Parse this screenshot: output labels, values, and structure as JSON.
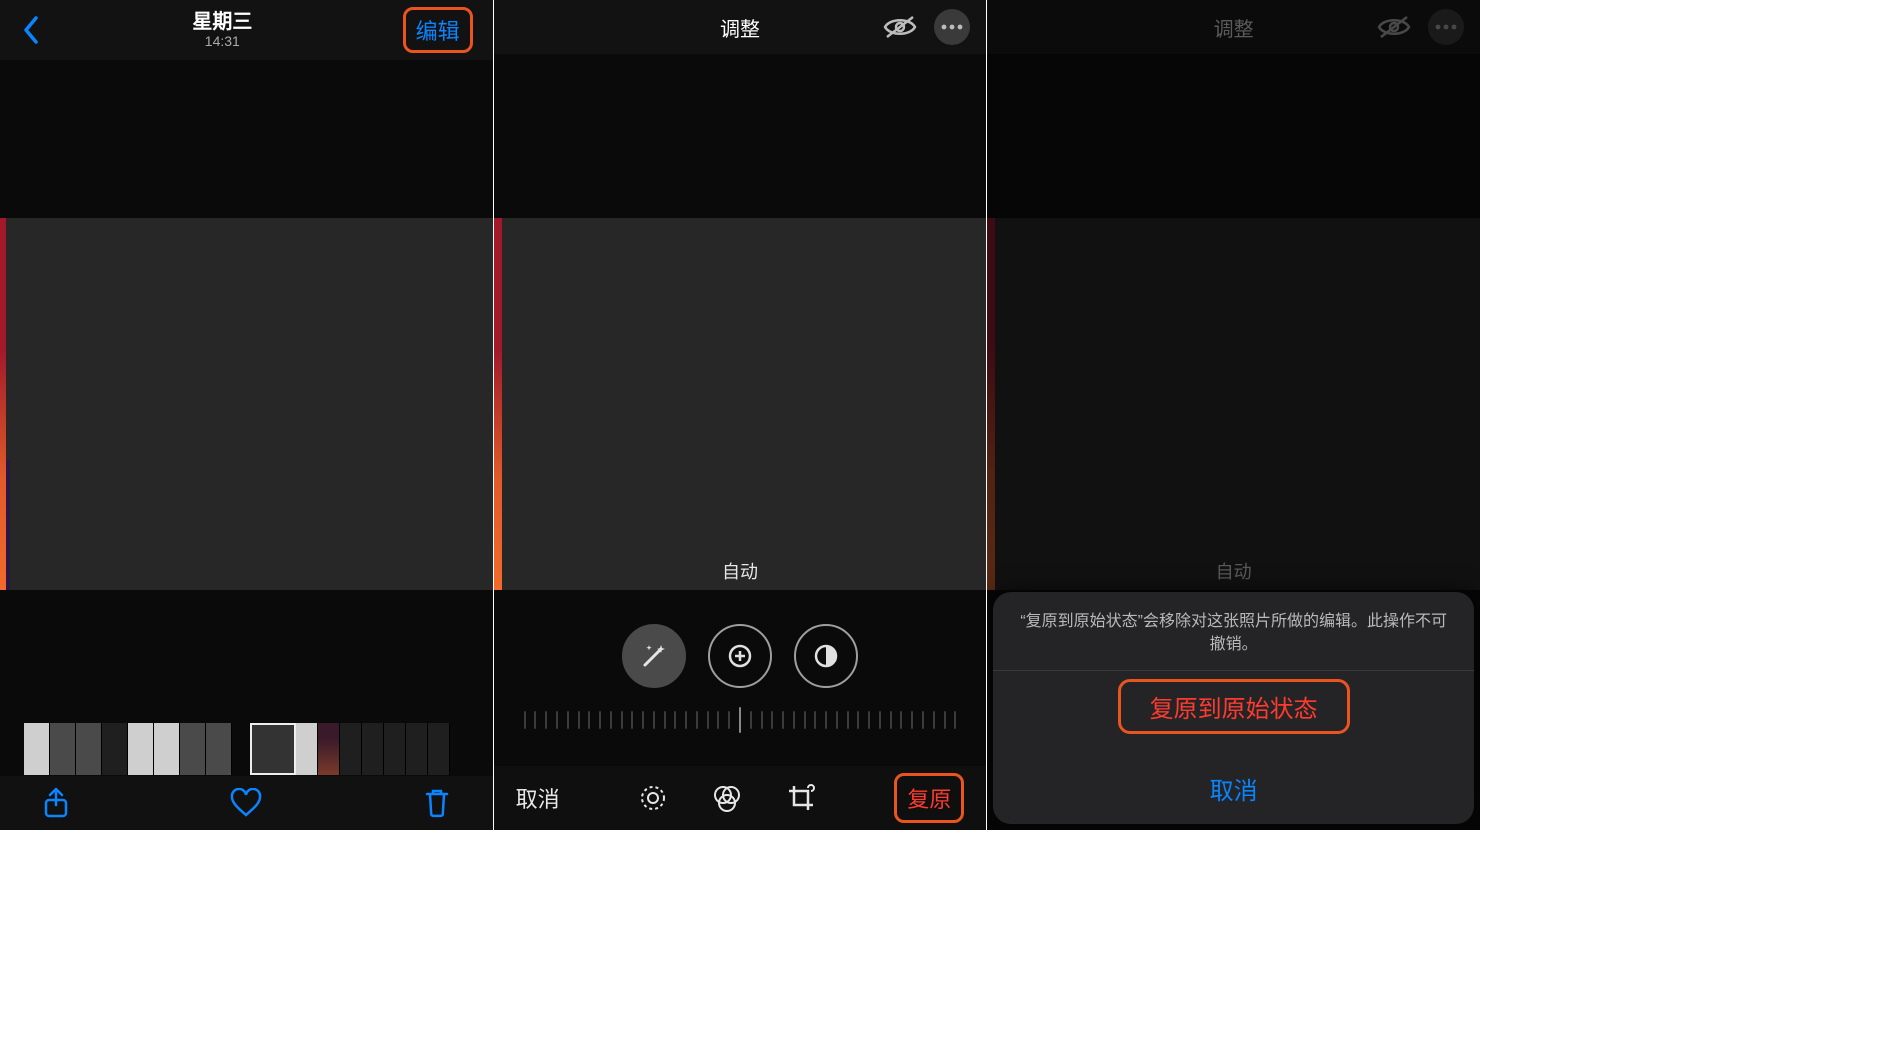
{
  "colors": {
    "ios_blue": "#0a84ff",
    "ios_red": "#ff3b30",
    "highlight_box": "#e9541f"
  },
  "panel1": {
    "title_day": "星期三",
    "title_time": "14:31",
    "edit_label": "编辑",
    "toolbar": {
      "share_icon": "share-icon",
      "favorite_icon": "heart-icon",
      "delete_icon": "trash-icon"
    }
  },
  "panel2": {
    "header_title": "调整",
    "auto_label": "自动",
    "dials": [
      {
        "name": "auto-wand",
        "active": true
      },
      {
        "name": "exposure",
        "active": false
      },
      {
        "name": "brilliance",
        "active": false
      }
    ],
    "bottom": {
      "cancel_label": "取消",
      "restore_label": "复原",
      "modes": [
        {
          "name": "adjust-icon"
        },
        {
          "name": "filters-icon"
        },
        {
          "name": "crop-icon"
        }
      ]
    }
  },
  "panel3": {
    "header_title": "调整",
    "auto_label": "自动",
    "sheet": {
      "message": "“复原到原始状态”会移除对这张照片所做的编辑。此操作不可撤销。",
      "confirm_label": "复原到原始状态",
      "cancel_label": "取消"
    }
  }
}
